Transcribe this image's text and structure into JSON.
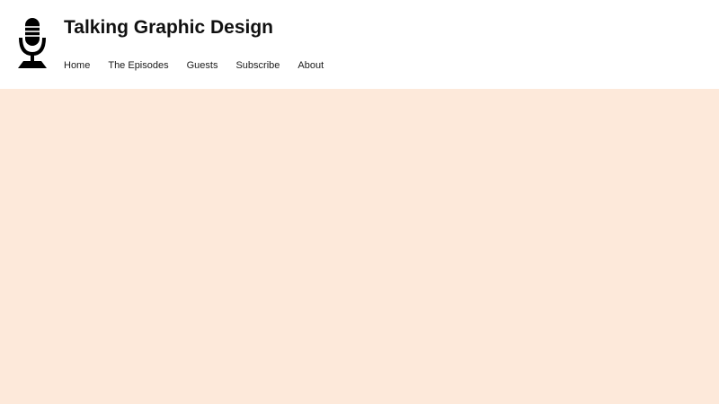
{
  "header": {
    "logo_icon": "microphone-icon",
    "title": "Talking Graphic Design"
  },
  "nav": {
    "items": [
      {
        "label": "Home"
      },
      {
        "label": "The Episodes"
      },
      {
        "label": "Guests"
      },
      {
        "label": "Subscribe"
      },
      {
        "label": "About"
      }
    ]
  },
  "colors": {
    "header_background": "#ffffff",
    "page_background": "#fde9da",
    "text": "#111111"
  }
}
